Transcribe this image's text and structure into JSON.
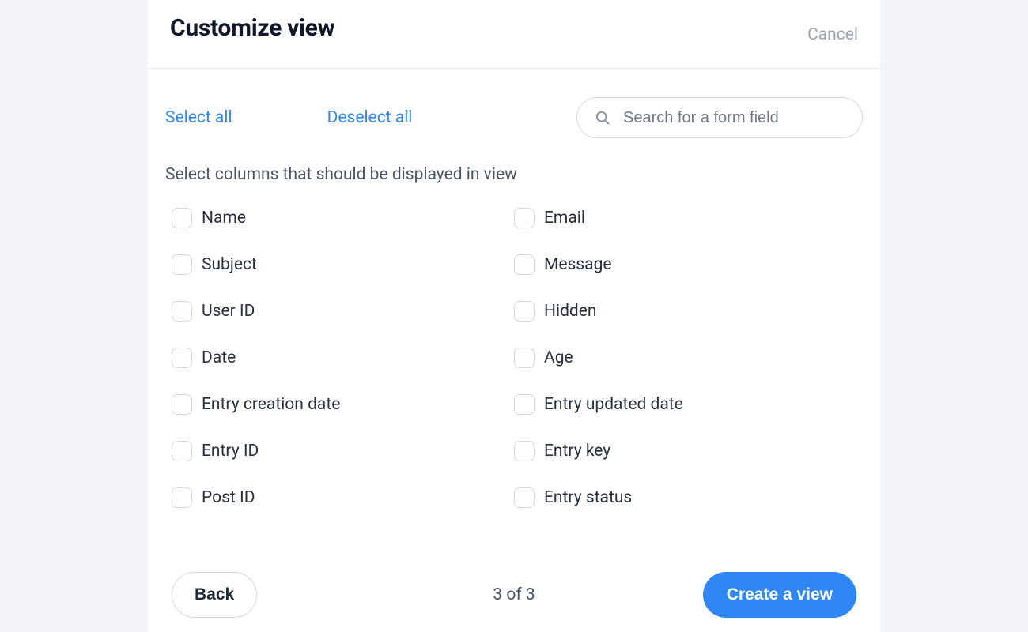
{
  "header": {
    "title": "Customize view",
    "cancel": "Cancel"
  },
  "toolbar": {
    "select_all": "Select all",
    "deselect_all": "Deselect all",
    "search_placeholder": "Search for a form field"
  },
  "instruction": "Select columns that should be displayed in view",
  "columns": [
    {
      "label": "Name"
    },
    {
      "label": "Email"
    },
    {
      "label": "Subject"
    },
    {
      "label": "Message"
    },
    {
      "label": "User ID"
    },
    {
      "label": "Hidden"
    },
    {
      "label": "Date"
    },
    {
      "label": "Age"
    },
    {
      "label": "Entry creation date"
    },
    {
      "label": "Entry updated date"
    },
    {
      "label": "Entry ID"
    },
    {
      "label": "Entry key"
    },
    {
      "label": "Post ID"
    },
    {
      "label": "Entry status"
    }
  ],
  "footer": {
    "back": "Back",
    "step": "3 of 3",
    "create": "Create a view"
  }
}
